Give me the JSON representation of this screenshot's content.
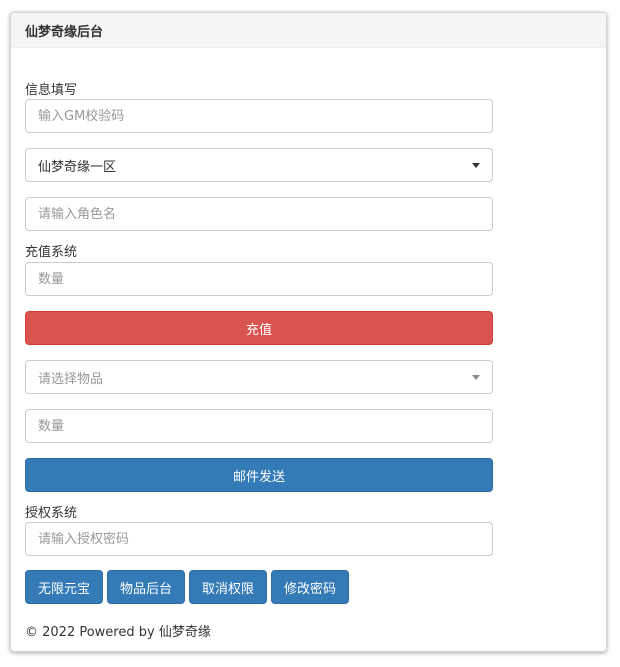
{
  "panel": {
    "title": "仙梦奇缘后台"
  },
  "info": {
    "section_label": "信息填写",
    "gm_code_placeholder": "输入GM校验码",
    "server_selected": "仙梦奇缘一区",
    "role_name_placeholder": "请输入角色名"
  },
  "recharge": {
    "section_label": "充值系统",
    "amount_placeholder": "数量",
    "button_label": "充值",
    "item_select_placeholder": "请选择物品",
    "item_amount_placeholder": "数量",
    "mail_button_label": "邮件发送"
  },
  "auth": {
    "section_label": "授权系统",
    "password_placeholder": "请输入授权密码",
    "buttons": [
      "无限元宝",
      "物品后台",
      "取消权限",
      "修改密码"
    ]
  },
  "footer": {
    "text": "© 2022 Powered by 仙梦奇缘"
  },
  "colors": {
    "danger": "#d9534f",
    "primary": "#337ab7",
    "heading_bg": "#f5f5f5"
  },
  "icons": {
    "dropdown": "caret-down-icon"
  }
}
